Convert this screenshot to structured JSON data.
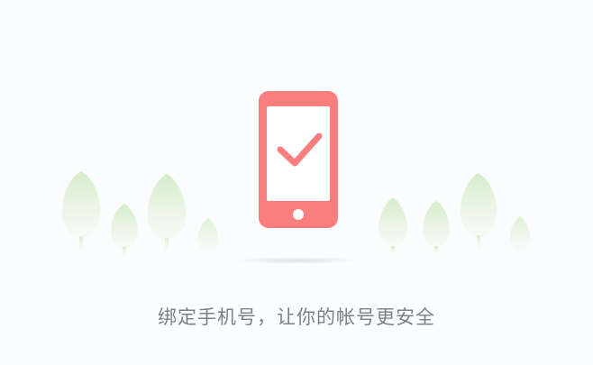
{
  "illustration": {
    "subject": "phone-with-checkmark",
    "phone_color": "#f97f7f",
    "screen_color": "#ffffff",
    "tree_color": "#d6eccb",
    "shadow_color": "#e3e5e7"
  },
  "caption": {
    "text": "绑定手机号，让你的帐号更安全",
    "color": "#7c7f83"
  }
}
